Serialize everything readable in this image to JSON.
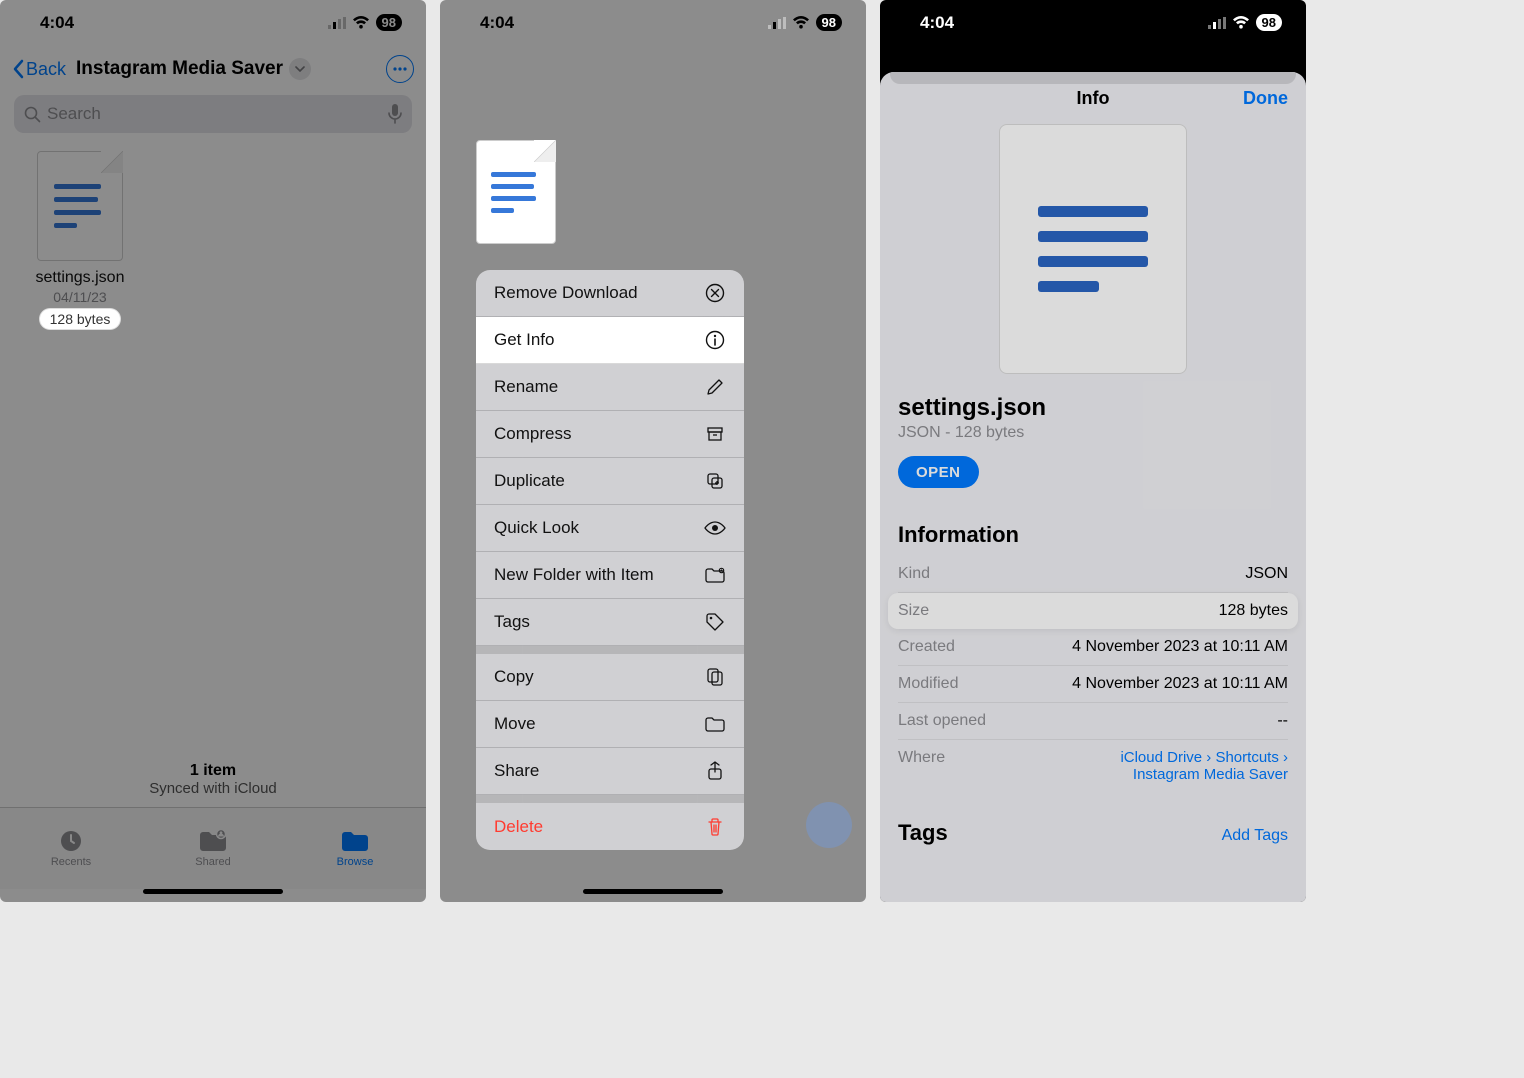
{
  "status": {
    "time": "4:04",
    "battery": "98"
  },
  "screen1": {
    "back": "Back",
    "title": "Instagram Media Saver",
    "search_placeholder": "Search",
    "file": {
      "name": "settings.json",
      "date": "04/11/23",
      "size": "128 bytes"
    },
    "footer": {
      "count": "1 item",
      "sync": "Synced with iCloud"
    },
    "tabs": {
      "recents": "Recents",
      "shared": "Shared",
      "browse": "Browse"
    }
  },
  "screen2": {
    "menu": {
      "remove_download": "Remove Download",
      "get_info": "Get Info",
      "rename": "Rename",
      "compress": "Compress",
      "duplicate": "Duplicate",
      "quick_look": "Quick Look",
      "new_folder": "New Folder with Item",
      "tags": "Tags",
      "copy": "Copy",
      "move": "Move",
      "share": "Share",
      "delete": "Delete"
    }
  },
  "screen3": {
    "sheet_title": "Info",
    "done": "Done",
    "file_name": "settings.json",
    "file_sub": "JSON - 128 bytes",
    "open": "OPEN",
    "section_info": "Information",
    "rows": {
      "kind_k": "Kind",
      "kind_v": "JSON",
      "size_k": "Size",
      "size_v": "128 bytes",
      "created_k": "Created",
      "created_v": "4 November 2023 at 10:11 AM",
      "modified_k": "Modified",
      "modified_v": "4 November 2023 at 10:11 AM",
      "last_k": "Last opened",
      "last_v": "--",
      "where_k": "Where",
      "where_v1": "iCloud Drive › Shortcuts ›",
      "where_v2": "Instagram Media Saver"
    },
    "tags_h": "Tags",
    "add_tags": "Add Tags"
  }
}
